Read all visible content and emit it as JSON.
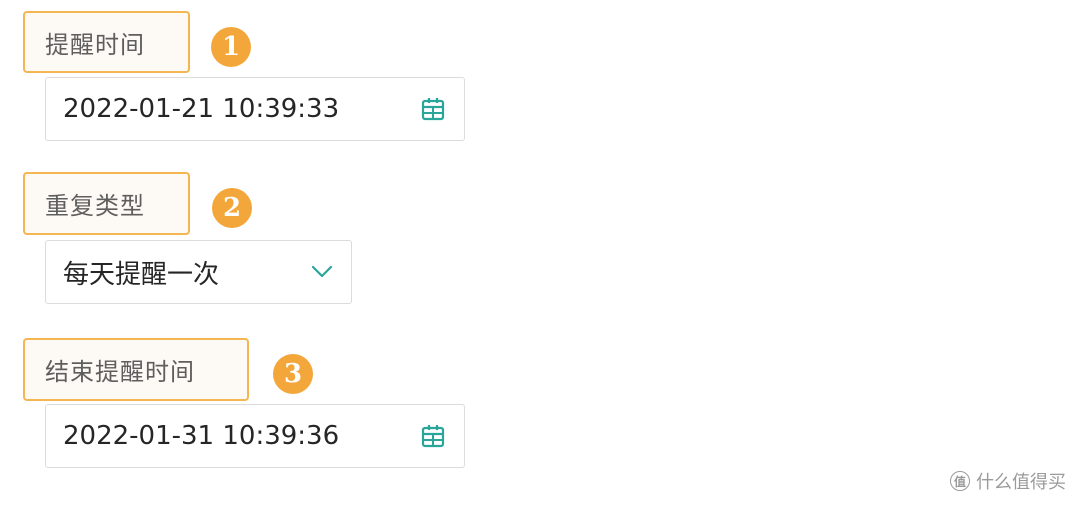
{
  "sections": [
    {
      "label": "提醒时间",
      "step": "1",
      "value": "2022-01-21 10:39:33",
      "icon": "calendar-icon"
    },
    {
      "label": "重复类型",
      "step": "2",
      "value": "每天提醒一次",
      "icon": "chevron-down-icon"
    },
    {
      "label": "结束提醒时间",
      "step": "3",
      "value": "2022-01-31 10:39:36",
      "icon": "calendar-icon"
    }
  ],
  "colors": {
    "label_border": "#f3b651",
    "badge": "#f3a73a",
    "icon_accent": "#2aa59a",
    "field_border": "#dcdcdc"
  },
  "watermark": {
    "text": "什么值得买",
    "logo": "值"
  }
}
